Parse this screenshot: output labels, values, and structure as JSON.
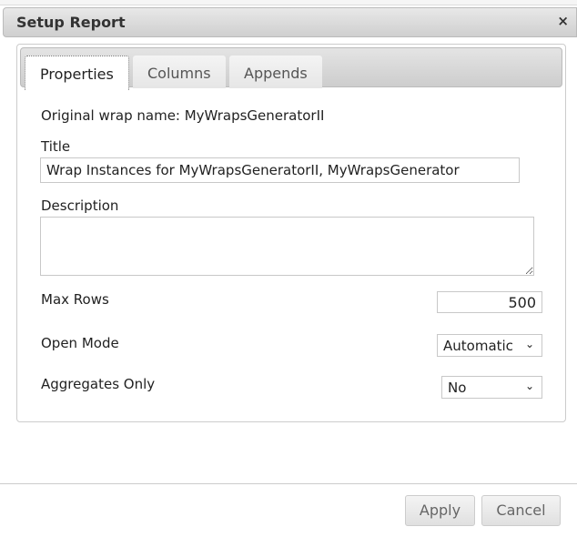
{
  "dialog": {
    "title": "Setup Report",
    "close": "×"
  },
  "tabs": [
    "Properties",
    "Columns",
    "Appends"
  ],
  "form": {
    "original_name": "Original wrap name: MyWrapsGeneratorII",
    "title_label": "Title",
    "title_value": "Wrap Instances for MyWrapsGeneratorII, MyWrapsGenerator",
    "description_label": "Description",
    "description_value": "",
    "max_rows_label": "Max Rows",
    "max_rows_value": "500",
    "open_mode_label": "Open Mode",
    "open_mode_value": "Automatic",
    "aggregates_label": "Aggregates Only",
    "aggregates_value": "No"
  },
  "buttons": {
    "apply": "Apply",
    "cancel": "Cancel"
  }
}
